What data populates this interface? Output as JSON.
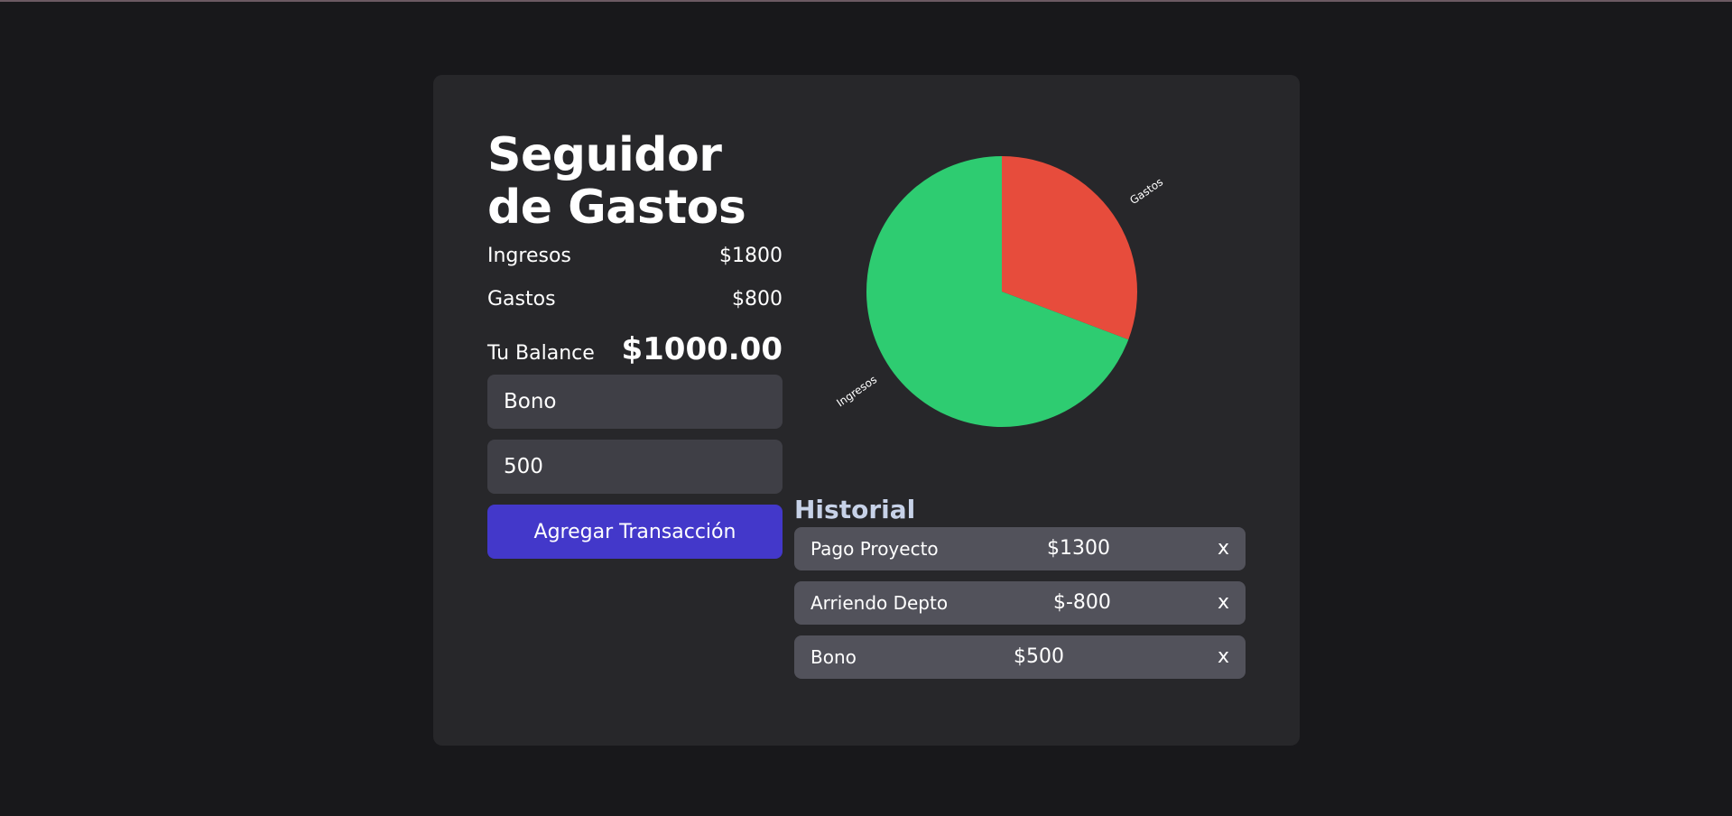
{
  "app": {
    "title": "Seguidor de Gastos"
  },
  "summary": {
    "income_label": "Ingresos",
    "income_value": "$1800",
    "expense_label": "Gastos",
    "expense_value": "$800",
    "balance_label": "Tu Balance",
    "balance_value": "$1000.00"
  },
  "form": {
    "name_value": "Bono",
    "amount_value": "500",
    "submit_label": "Agregar Transacción"
  },
  "history": {
    "title": "Historial",
    "items": [
      {
        "name": "Pago Proyecto",
        "amount": "$1300",
        "delete_label": "x"
      },
      {
        "name": "Arriendo Depto",
        "amount": "$-800",
        "delete_label": "x"
      },
      {
        "name": "Bono",
        "amount": "$500",
        "delete_label": "x"
      }
    ]
  },
  "chart_data": {
    "type": "pie",
    "categories": [
      "Gastos",
      "Ingresos"
    ],
    "values": [
      800,
      1800
    ],
    "colors": [
      "#e74c3c",
      "#2ecc71"
    ]
  }
}
